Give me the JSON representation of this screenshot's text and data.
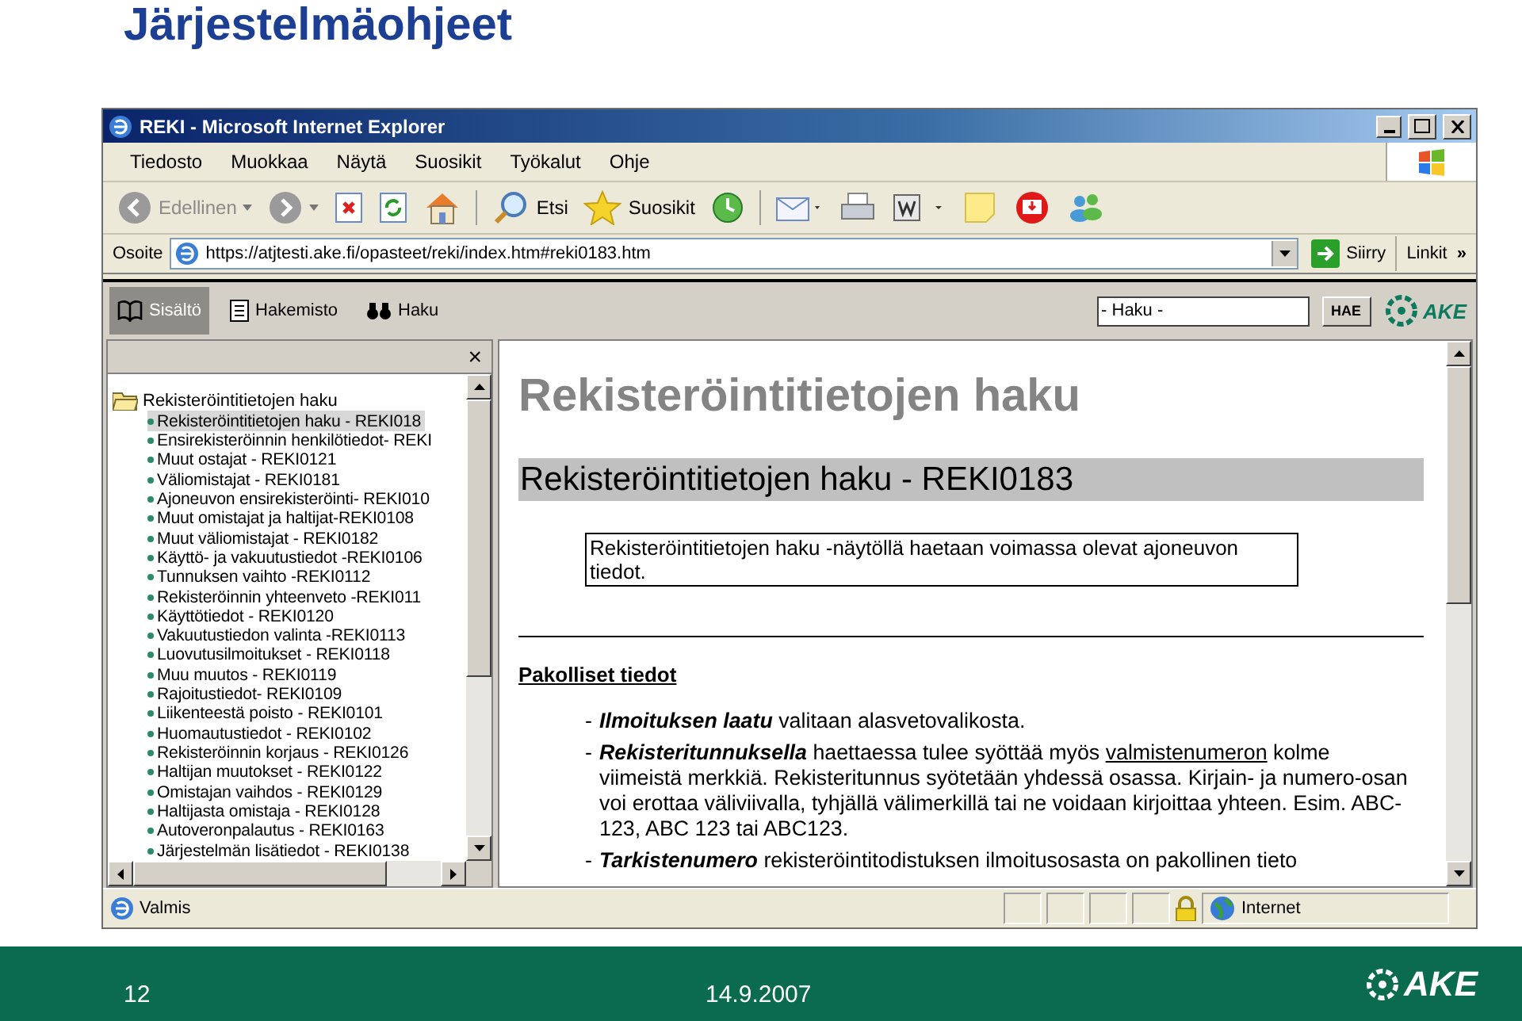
{
  "slide": {
    "title": "Järjestelmäohjeet",
    "page_number": "12",
    "date": "14.9.2007",
    "logo_text": "AKE"
  },
  "browser": {
    "title": "REKI - Microsoft Internet Explorer",
    "menu": [
      "Tiedosto",
      "Muokkaa",
      "Näytä",
      "Suosikit",
      "Työkalut",
      "Ohje"
    ],
    "toolbar": [
      {
        "kind": "back",
        "label": "Edellinen",
        "disabled": true
      },
      {
        "kind": "forward",
        "disabled": true
      },
      {
        "kind": "stop"
      },
      {
        "kind": "refresh"
      },
      {
        "kind": "home"
      },
      {
        "kind": "search",
        "label": "Etsi"
      },
      {
        "kind": "favorites",
        "label": "Suosikit"
      },
      {
        "kind": "history"
      },
      {
        "kind": "mail"
      },
      {
        "kind": "print"
      },
      {
        "kind": "word"
      },
      {
        "kind": "note"
      },
      {
        "kind": "monitor"
      },
      {
        "kind": "people"
      }
    ],
    "address_label": "Osoite",
    "address": "https://atjtesti.ake.fi/opasteet/reki/index.htm#reki0183.htm",
    "go_label": "Siirry",
    "links_label": "Linkit",
    "links_chevron": "»"
  },
  "help_tabs": [
    {
      "label": "Sisältö",
      "selected": true
    },
    {
      "label": "Hakemisto",
      "selected": false
    },
    {
      "label": "Haku",
      "selected": false
    }
  ],
  "help_search": {
    "value": "- Haku -",
    "button": "HAE",
    "logo_text": "AKE"
  },
  "tree": {
    "close": "×",
    "folder": "Rekisteröintitietojen haku",
    "items": [
      {
        "label": "Rekisteröintitietojen haku - REKI018",
        "selected": true
      },
      {
        "label": "Ensirekisteröinnin henkilötiedot- REKI",
        "selected": false
      },
      {
        "label": "Muut ostajat - REKI0121",
        "selected": false
      },
      {
        "label": "Väliomistajat - REKI0181",
        "selected": false
      },
      {
        "label": "Ajoneuvon ensirekisteröinti- REKI010",
        "selected": false
      },
      {
        "label": "Muut omistajat ja haltijat-REKI0108",
        "selected": false
      },
      {
        "label": "Muut väliomistajat - REKI0182",
        "selected": false
      },
      {
        "label": "Käyttö- ja vakuutustiedot -REKI0106",
        "selected": false
      },
      {
        "label": "Tunnuksen vaihto -REKI0112",
        "selected": false
      },
      {
        "label": "Rekisteröinnin yhteenveto -REKI011",
        "selected": false
      },
      {
        "label": "Käyttötiedot - REKI0120",
        "selected": false
      },
      {
        "label": "Vakuutustiedon valinta -REKI0113",
        "selected": false
      },
      {
        "label": "Luovutusilmoitukset - REKI0118",
        "selected": false
      },
      {
        "label": "Muu muutos - REKI0119",
        "selected": false
      },
      {
        "label": "Rajoitustiedot- REKI0109",
        "selected": false
      },
      {
        "label": "Liikenteestä poisto - REKI0101",
        "selected": false
      },
      {
        "label": "Huomautustiedot - REKI0102",
        "selected": false
      },
      {
        "label": "Rekisteröinnin korjaus - REKI0126",
        "selected": false
      },
      {
        "label": "Haltijan muutokset - REKI0122",
        "selected": false
      },
      {
        "label": "Omistajan vaihdos - REKI0129",
        "selected": false
      },
      {
        "label": "Haltijasta omistaja - REKI0128",
        "selected": false
      },
      {
        "label": "Autoveronpalautus - REKI0163",
        "selected": false
      },
      {
        "label": "Järjestelmän lisätiedot - REKI0138",
        "selected": false
      }
    ]
  },
  "content": {
    "heading": "Rekisteröintitietojen haku",
    "section": "Rekisteröintitietojen haku - REKI0183",
    "description": "Rekisteröintitietojen haku -näytöllä haetaan voimassa olevat ajoneuvon tiedot.",
    "subheading": "Pakolliset tiedot",
    "items": [
      {
        "marker": "-",
        "term": "Ilmoituksen laatu",
        "text": " valitaan alasvetovalikosta."
      },
      {
        "marker": "-",
        "term": "Rekisteritunnuksella",
        "text": " haettaessa tulee syöttää myös ",
        "link": "valmistenumeron",
        "text_after": " kolme viimeistä merkkiä. Rekisteritunnus syötetään yhdessä osassa. Kirjain- ja numero-osan voi erottaa väliviivalla, tyhjällä välimerkillä tai ne voidaan kirjoittaa yhteen. Esim. ABC-123, ABC 123 tai ABC123."
      },
      {
        "marker": "-",
        "term": "Tarkistenumero",
        "text": " rekisteröintitodistuksen ilmoitusosasta on pakollinen tieto"
      }
    ]
  },
  "status_bar": {
    "text": "Valmis",
    "zone": "Internet"
  }
}
